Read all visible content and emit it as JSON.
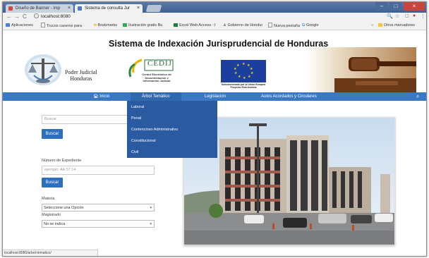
{
  "browser": {
    "tabs": [
      {
        "label": "Diseño de Banner - imp",
        "favicon_color": "#d6473b",
        "active": false
      },
      {
        "label": "Sistema de consulta Jur",
        "favicon_color": "#4b7dc4",
        "active": true
      }
    ],
    "address": "localhost:8080",
    "bookmarks": [
      {
        "label": "Aplicaciones",
        "color": "#4a7fd1"
      },
      {
        "label": "Trucos caseros para",
        "color": "#c8c8c8"
      },
      {
        "label": "Bookmarks",
        "color": "#f5b400"
      },
      {
        "label": "Ilustración gratis Bu",
        "color": "#35a853"
      },
      {
        "label": "Excel Web Access - I",
        "color": "#1f7a3c"
      },
      {
        "label": "Gobierno de Hondur",
        "color": "#888888"
      },
      {
        "label": "Nueva pestaña",
        "color": "#c8c8c8"
      },
      {
        "label": "Google",
        "color": "#4285f4"
      },
      {
        "label": "Otros marcadores",
        "color": "#f5c542"
      }
    ],
    "status_url": "localhost:8080/arbol-tematico/"
  },
  "header": {
    "title": "Sistema de Indexación Jurisprudencial de Honduras",
    "pj_line1": "Poder Judicial",
    "pj_line2": "Honduras",
    "cedij_name": "CEDIJ",
    "cedij_sub1": "Centro Electrónico de",
    "cedij_sub2": "Documentación e",
    "cedij_sub3": "Información Judicial",
    "eu_line1": "Subvencionado por la Unión Europea",
    "eu_line2": "Proyecto EuroJusticia"
  },
  "nav": {
    "items": [
      "Inicio",
      "Árbol Temático",
      "Legislación",
      "Autos Acordados y Circulares"
    ],
    "color": "#3a78c3"
  },
  "dropdown": {
    "items": [
      "Laboral",
      "Penal",
      "Contencioso Administrativo",
      "Constitucional",
      "Civil"
    ]
  },
  "form": {
    "search_placeholder": "Buscar",
    "search_button": "Buscar",
    "expediente_label": "Número de Expediente",
    "expediente_placeholder": "ejemplo: AA 57 14",
    "expediente_button": "Buscar",
    "materia_label": "Materia",
    "materia_value": "Seleccione una Opción",
    "magistrado_label": "Magistrado",
    "magistrado_value": "No se indica"
  }
}
